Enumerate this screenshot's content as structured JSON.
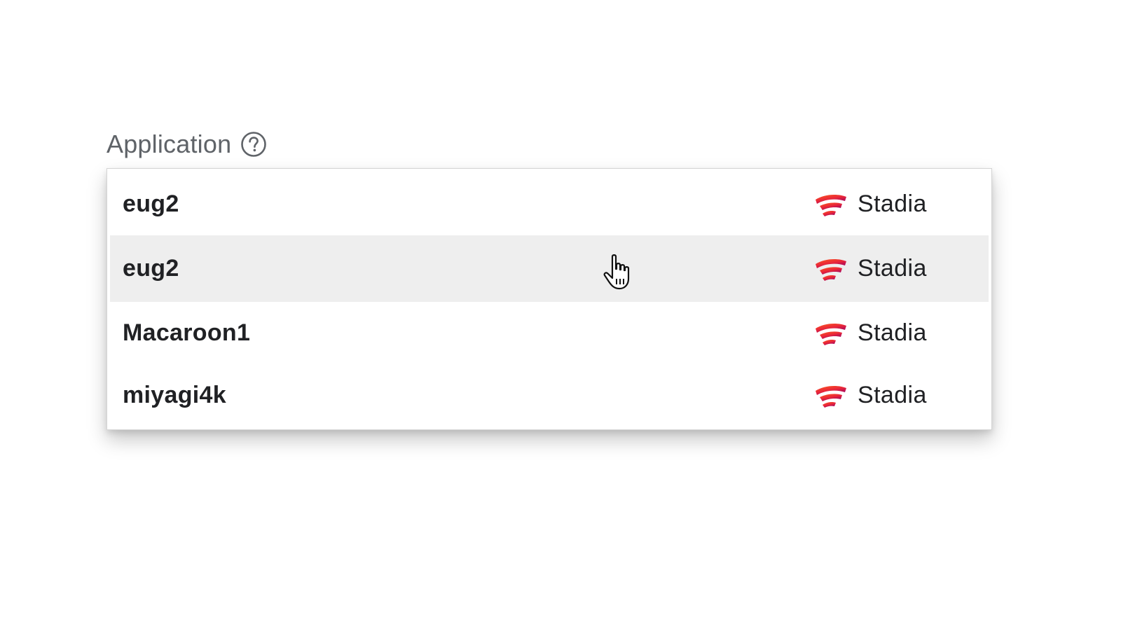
{
  "field": {
    "label": "Application",
    "help_icon": "help-circle-icon"
  },
  "options": [
    {
      "name": "eug2",
      "platform": "Stadia",
      "hovered": false
    },
    {
      "name": "eug2",
      "platform": "Stadia",
      "hovered": true
    },
    {
      "name": "Macaroon1",
      "platform": "Stadia",
      "hovered": false
    },
    {
      "name": "miyagi4k",
      "platform": "Stadia",
      "hovered": false
    }
  ],
  "platform_logo_icon": "stadia-logo-icon",
  "cursor_icon": "hand-pointer-icon",
  "colors": {
    "label": "#5f6368",
    "text": "#202124",
    "hover_bg": "#eeeeee",
    "stadia_orange": "#ff4c1d",
    "stadia_magenta": "#9b0063"
  }
}
